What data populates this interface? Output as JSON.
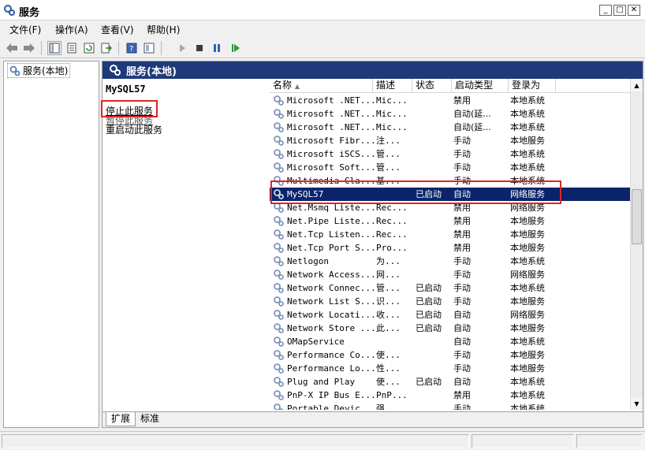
{
  "window": {
    "title": "服务",
    "minimize": "_",
    "maximize": "□",
    "close": "✕"
  },
  "menu": [
    "文件(F)",
    "操作(A)",
    "查看(V)",
    "帮助(H)"
  ],
  "toolbar": {
    "icons": [
      "back-icon",
      "forward-icon",
      "show-tree-icon",
      "properties-icon",
      "refresh-icon",
      "export-icon",
      "help-icon",
      "view-icon",
      "start-icon",
      "stop-icon",
      "pause-icon",
      "restart-icon"
    ]
  },
  "tree": {
    "root_label": "服务(本地)"
  },
  "right_header": {
    "title": "服务(本地)"
  },
  "detail": {
    "service_name": "MySQL57",
    "stop_label": "停止此服务",
    "pause_label": "暂停此服务",
    "restart_label": "重启动此服务"
  },
  "columns": [
    "名称",
    "描述",
    "状态",
    "启动类型",
    "登录为"
  ],
  "rows": [
    {
      "name": "Microsoft .NET...",
      "desc": "Mic...",
      "status": "",
      "start": "禁用",
      "logon": "本地系统"
    },
    {
      "name": "Microsoft .NET...",
      "desc": "Mic...",
      "status": "",
      "start": "自动(延...",
      "logon": "本地系统"
    },
    {
      "name": "Microsoft .NET...",
      "desc": "Mic...",
      "status": "",
      "start": "自动(延...",
      "logon": "本地系统"
    },
    {
      "name": "Microsoft Fibr...",
      "desc": "注...",
      "status": "",
      "start": "手动",
      "logon": "本地服务"
    },
    {
      "name": "Microsoft iSCS...",
      "desc": "管...",
      "status": "",
      "start": "手动",
      "logon": "本地系统"
    },
    {
      "name": "Microsoft Soft...",
      "desc": "管...",
      "status": "",
      "start": "手动",
      "logon": "本地系统"
    },
    {
      "name": "Multimedia Cla...",
      "desc": "基...",
      "status": "",
      "start": "手动",
      "logon": "本地系统"
    },
    {
      "name": "MySQL57",
      "desc": "",
      "status": "已启动",
      "start": "自动",
      "logon": "网络服务",
      "selected": true
    },
    {
      "name": "Net.Msmq Liste...",
      "desc": "Rec...",
      "status": "",
      "start": "禁用",
      "logon": "网络服务"
    },
    {
      "name": "Net.Pipe Liste...",
      "desc": "Rec...",
      "status": "",
      "start": "禁用",
      "logon": "本地服务"
    },
    {
      "name": "Net.Tcp Listen...",
      "desc": "Rec...",
      "status": "",
      "start": "禁用",
      "logon": "本地服务"
    },
    {
      "name": "Net.Tcp Port S...",
      "desc": "Pro...",
      "status": "",
      "start": "禁用",
      "logon": "本地服务"
    },
    {
      "name": "Netlogon",
      "desc": "为...",
      "status": "",
      "start": "手动",
      "logon": "本地系统"
    },
    {
      "name": "Network Access...",
      "desc": "网...",
      "status": "",
      "start": "手动",
      "logon": "网络服务"
    },
    {
      "name": "Network Connec...",
      "desc": "管...",
      "status": "已启动",
      "start": "手动",
      "logon": "本地系统"
    },
    {
      "name": "Network List S...",
      "desc": "识...",
      "status": "已启动",
      "start": "手动",
      "logon": "本地服务"
    },
    {
      "name": "Network Locati...",
      "desc": "收...",
      "status": "已启动",
      "start": "自动",
      "logon": "网络服务"
    },
    {
      "name": "Network Store ...",
      "desc": "此...",
      "status": "已启动",
      "start": "自动",
      "logon": "本地服务"
    },
    {
      "name": "OMapService",
      "desc": "",
      "status": "",
      "start": "自动",
      "logon": "本地系统"
    },
    {
      "name": "Performance Co...",
      "desc": "使...",
      "status": "",
      "start": "手动",
      "logon": "本地服务"
    },
    {
      "name": "Performance Lo...",
      "desc": "性...",
      "status": "",
      "start": "手动",
      "logon": "本地服务"
    },
    {
      "name": "Plug and Play",
      "desc": "使...",
      "status": "已启动",
      "start": "自动",
      "logon": "本地系统"
    },
    {
      "name": "PnP-X IP Bus E...",
      "desc": "PnP...",
      "status": "",
      "start": "禁用",
      "logon": "本地系统"
    },
    {
      "name": "Portable Devic...",
      "desc": "强...",
      "status": "",
      "start": "手动",
      "logon": "本地系统"
    }
  ],
  "tabs": [
    "扩展",
    "标准"
  ],
  "colors": {
    "header_blue": "#1e3a7a",
    "selection": "#0a246a",
    "highlight_red": "#e02525"
  }
}
